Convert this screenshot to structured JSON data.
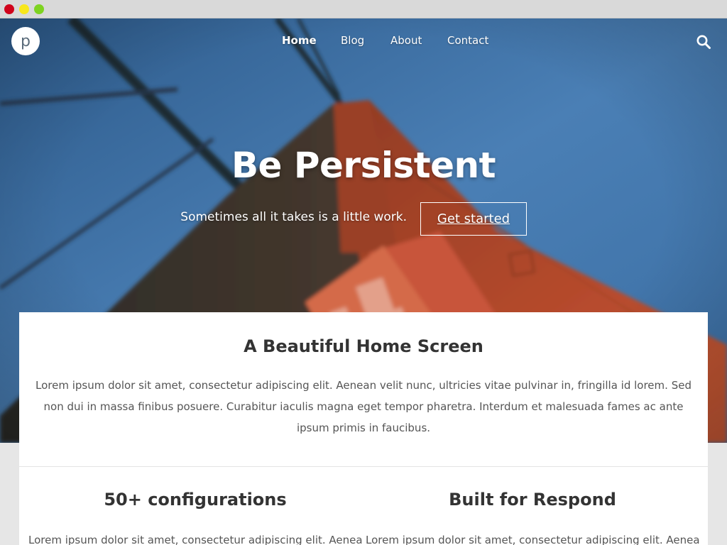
{
  "nav": {
    "logo_letter": "p",
    "items": [
      {
        "label": "Home",
        "active": true
      },
      {
        "label": "Blog",
        "active": false
      },
      {
        "label": "About",
        "active": false
      },
      {
        "label": "Contact",
        "active": false
      }
    ],
    "search_icon": "search-icon"
  },
  "hero": {
    "title": "Be Persistent",
    "subtitle": "Sometimes all it takes is a little work.",
    "cta_label": "Get started"
  },
  "intro": {
    "title": "A Beautiful Home Screen",
    "text": "Lorem ipsum dolor sit amet, consectetur adipiscing elit. Aenean velit nunc, ultricies vitae pulvinar in, fringilla id lorem. Sed non dui in massa finibus posuere. Curabitur iaculis magna eget tempor pharetra. Interdum et malesuada fames ac ante ipsum primis in faucibus."
  },
  "features": [
    {
      "title": "50+ configurations",
      "text": "Lorem ipsum dolor sit amet, consectetur adipiscing elit. Aenean"
    },
    {
      "title": "Built for Respond",
      "text": "Lorem ipsum dolor sit amet, consectetur adipiscing elit. Aenean"
    }
  ],
  "colors": {
    "window_close": "#d0021b",
    "window_minimize": "#f8e71c",
    "window_maximize": "#7ed321",
    "sky": "#3f73a6",
    "bridge": "#b0452a",
    "card_background": "#ffffff",
    "page_background": "#e6e6e6"
  }
}
